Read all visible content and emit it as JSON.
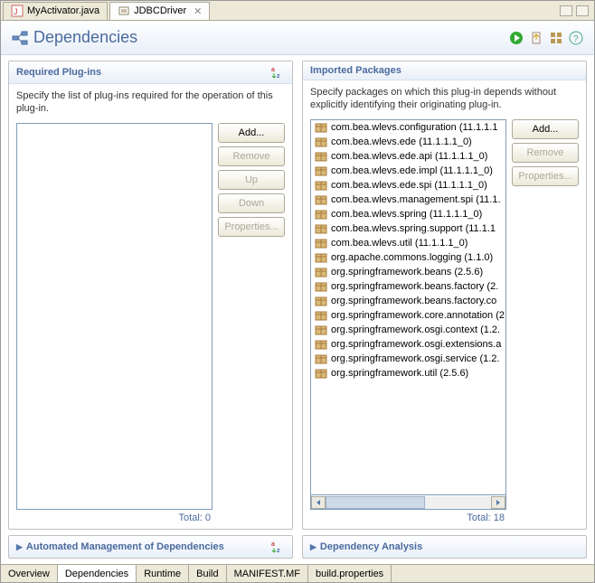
{
  "tabs_top": [
    {
      "label": "MyActivator.java",
      "active": false
    },
    {
      "label": "JDBCDriver",
      "active": true
    }
  ],
  "header": {
    "title": "Dependencies"
  },
  "panels": {
    "required": {
      "title": "Required Plug-ins",
      "desc": "Specify the list of plug-ins required for the operation of this plug-in.",
      "total_label": "Total: 0",
      "buttons": {
        "add": "Add...",
        "remove": "Remove",
        "up": "Up",
        "down": "Down",
        "props": "Properties..."
      }
    },
    "imported": {
      "title": "Imported Packages",
      "desc": "Specify packages on which this plug-in depends without explicitly identifying their originating plug-in.",
      "total_label": "Total: 18",
      "buttons": {
        "add": "Add...",
        "remove": "Remove",
        "props": "Properties..."
      },
      "items": [
        "com.bea.wlevs.configuration (11.1.1.1",
        "com.bea.wlevs.ede (11.1.1.1_0)",
        "com.bea.wlevs.ede.api (11.1.1.1_0)",
        "com.bea.wlevs.ede.impl (11.1.1.1_0)",
        "com.bea.wlevs.ede.spi (11.1.1.1_0)",
        "com.bea.wlevs.management.spi (11.1.",
        "com.bea.wlevs.spring (11.1.1.1_0)",
        "com.bea.wlevs.spring.support (11.1.1",
        "com.bea.wlevs.util (11.1.1.1_0)",
        "org.apache.commons.logging (1.1.0)",
        "org.springframework.beans (2.5.6)",
        "org.springframework.beans.factory (2.",
        "org.springframework.beans.factory.co",
        "org.springframework.core.annotation (2",
        "org.springframework.osgi.context (1.2.",
        "org.springframework.osgi.extensions.a",
        "org.springframework.osgi.service (1.2.",
        "org.springframework.util (2.5.6)"
      ]
    }
  },
  "expand": {
    "auto": "Automated Management of Dependencies",
    "analysis": "Dependency Analysis"
  },
  "tabs_bottom": [
    "Overview",
    "Dependencies",
    "Runtime",
    "Build",
    "MANIFEST.MF",
    "build.properties"
  ],
  "active_bottom": "Dependencies"
}
